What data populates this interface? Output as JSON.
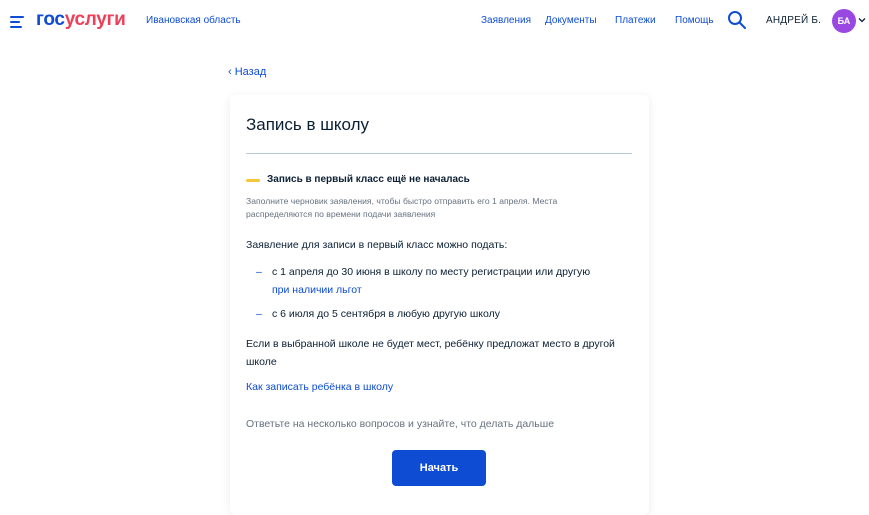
{
  "header": {
    "logo_part1": "гос",
    "logo_part2": "услуги",
    "region": "Ивановская область",
    "nav": [
      "Заявления",
      "Документы",
      "Платежи",
      "Помощь"
    ],
    "user_name": "АНДРЕЙ Б.",
    "avatar_initials": "БА",
    "colors": {
      "brand_blue": "#0d4cd3",
      "brand_red": "#ee3f58",
      "avatar": "#9a48e2"
    },
    "icons": [
      "menu-icon",
      "search-icon",
      "chevron-down-icon"
    ]
  },
  "back_link": "‹ Назад",
  "card": {
    "title": "Запись в школу",
    "status": {
      "title": "Запись в первый класс ещё не началась",
      "description": "Заполните черновик заявления, чтобы быстро отправить его 1 апреля. Места распределяются по времени подачи заявления",
      "color": "#f5c63b"
    },
    "intro": "Заявление для записи в первый класс можно подать:",
    "items": [
      {
        "dash": "–",
        "text": "с 1 апреля до 30 июня в школу по месту регистрации или другую",
        "link": "при наличии льгот"
      },
      {
        "dash": "–",
        "text": "с 6 июля до 5 сентября в любую другую школу"
      }
    ],
    "note": "Если в выбранной школе не будет мест, ребёнку предложат место в другой школе",
    "howto_link": "Как записать ребёнка в школу",
    "hint": "Ответьте на несколько вопросов и узнайте, что делать дальше",
    "start_button": "Начать"
  }
}
